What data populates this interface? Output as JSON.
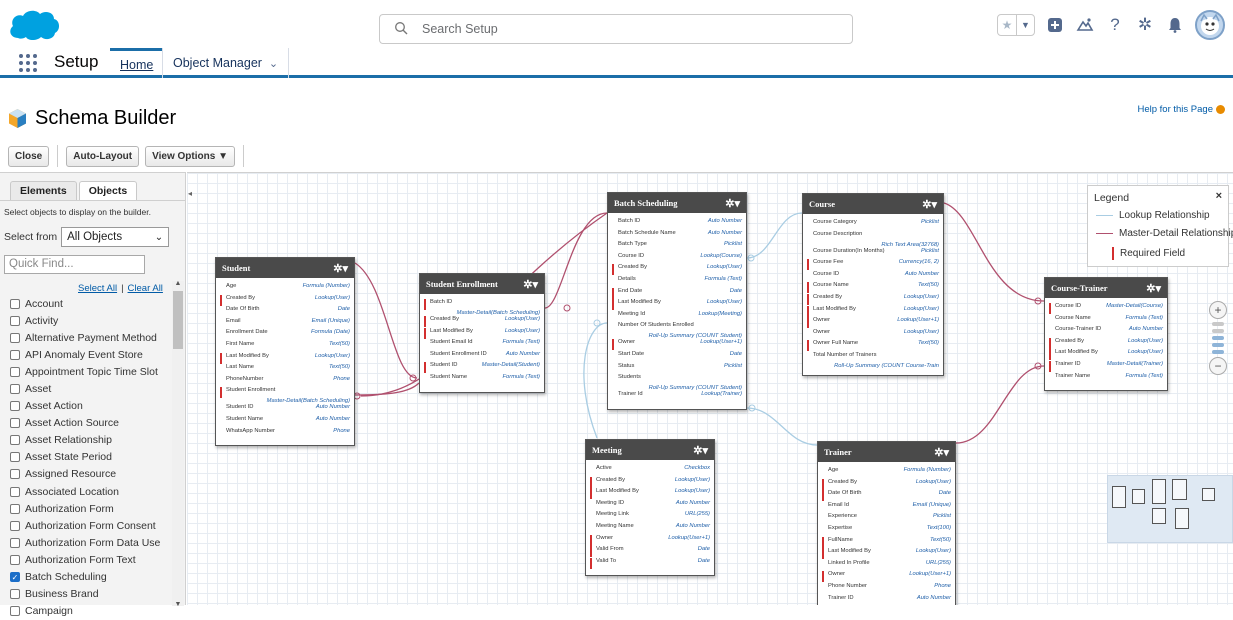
{
  "header": {
    "search_placeholder": "Search Setup",
    "brand_color": "#00a1e0",
    "icons": [
      "star-icon",
      "chevron-down-icon",
      "add-icon",
      "trailhead-icon",
      "help-icon",
      "gear-icon",
      "bell-icon",
      "avatar"
    ]
  },
  "context": {
    "app_name": "Setup",
    "tabs": [
      {
        "label": "Home"
      },
      {
        "label": "Object Manager"
      }
    ]
  },
  "page": {
    "title": "Schema Builder",
    "help_link": "Help for this Page"
  },
  "toolbar": {
    "close": "Close",
    "auto_layout": "Auto-Layout",
    "view_options": "View Options ▼"
  },
  "left_panel": {
    "tabs": [
      "Elements",
      "Objects"
    ],
    "hint": "Select objects to display on the builder.",
    "select_from_label": "Select from",
    "select_from_value": "All Objects",
    "quick_find_placeholder": "Quick Find...",
    "select_all": "Select All",
    "clear_all": "Clear All",
    "objects": [
      {
        "name": "Account",
        "checked": false
      },
      {
        "name": "Activity",
        "checked": false
      },
      {
        "name": "Alternative Payment Method",
        "checked": false
      },
      {
        "name": "API Anomaly Event Store",
        "checked": false
      },
      {
        "name": "Appointment Topic Time Slot",
        "checked": false
      },
      {
        "name": "Asset",
        "checked": false
      },
      {
        "name": "Asset Action",
        "checked": false
      },
      {
        "name": "Asset Action Source",
        "checked": false
      },
      {
        "name": "Asset Relationship",
        "checked": false
      },
      {
        "name": "Asset State Period",
        "checked": false
      },
      {
        "name": "Assigned Resource",
        "checked": false
      },
      {
        "name": "Associated Location",
        "checked": false
      },
      {
        "name": "Authorization Form",
        "checked": false
      },
      {
        "name": "Authorization Form Consent",
        "checked": false
      },
      {
        "name": "Authorization Form Data Use",
        "checked": false
      },
      {
        "name": "Authorization Form Text",
        "checked": false
      },
      {
        "name": "Batch Scheduling",
        "checked": true
      },
      {
        "name": "Business Brand",
        "checked": false
      },
      {
        "name": "Campaign",
        "checked": false
      }
    ]
  },
  "legend": {
    "title": "Legend",
    "lookup": "Lookup Relationship",
    "master_detail": "Master-Detail Relationship",
    "required": "Required Field",
    "lookup_color": "#a9cde3",
    "master_detail_color": "#b0506e",
    "required_color": "#d32f2f"
  },
  "nodes": {
    "student": {
      "title": "Student",
      "fields": [
        {
          "name": "Age",
          "type": "Formula (Number)",
          "req": false
        },
        {
          "name": "Created By",
          "type": "Lookup(User)",
          "req": true
        },
        {
          "name": "Date Of Birth",
          "type": "Date",
          "req": false
        },
        {
          "name": "Email",
          "type": "Email (Unique)",
          "req": false
        },
        {
          "name": "Enrollment Date",
          "type": "Formula (Date)",
          "req": false
        },
        {
          "name": "First Name",
          "type": "Text(50)",
          "req": false
        },
        {
          "name": "Last Modified By",
          "type": "Lookup(User)",
          "req": true
        },
        {
          "name": "Last Name",
          "type": "Text(50)",
          "req": false
        },
        {
          "name": "PhoneNumber",
          "type": "Phone",
          "req": false
        },
        {
          "name": "Student Enrollment",
          "type": "Master-Detail(Batch Scheduling)",
          "req": true,
          "two": true
        },
        {
          "name": "Student ID",
          "type": "Auto Number",
          "req": false
        },
        {
          "name": "Student Name",
          "type": "Auto Number",
          "req": false
        },
        {
          "name": "WhatsApp Number",
          "type": "Phone",
          "req": false
        }
      ]
    },
    "enrollment": {
      "title": "Student Enrollment",
      "fields": [
        {
          "name": "Batch ID",
          "type": "Master-Detail(Batch Scheduling)",
          "req": true,
          "two": true
        },
        {
          "name": "Created By",
          "type": "Lookup(User)",
          "req": true
        },
        {
          "name": "Last Modified By",
          "type": "Lookup(User)",
          "req": true
        },
        {
          "name": "Student Email Id",
          "type": "Formula (Text)",
          "req": false
        },
        {
          "name": "Student Enrollment ID",
          "type": "Auto Number",
          "req": false
        },
        {
          "name": "Student ID",
          "type": "Master-Detail(Student)",
          "req": true
        },
        {
          "name": "Student Name",
          "type": "Formula (Text)",
          "req": false
        }
      ]
    },
    "batch": {
      "title": "Batch Scheduling",
      "fields": [
        {
          "name": "Batch ID",
          "type": "Auto Number",
          "req": false
        },
        {
          "name": "Batch Schedule Name",
          "type": "Auto Number",
          "req": false
        },
        {
          "name": "Batch Type",
          "type": "Picklist",
          "req": false
        },
        {
          "name": "Course ID",
          "type": "Lookup(Course)",
          "req": false
        },
        {
          "name": "Created By",
          "type": "Lookup(User)",
          "req": true
        },
        {
          "name": "Details",
          "type": "Formula (Text)",
          "req": false
        },
        {
          "name": "End Date",
          "type": "Date",
          "req": true
        },
        {
          "name": "Last Modified By",
          "type": "Lookup(User)",
          "req": true
        },
        {
          "name": "Meeting Id",
          "type": "Lookup(Meeting)",
          "req": false
        },
        {
          "name": "Number Of Students Enrolled",
          "type": "Roll-Up Summary (COUNT Student)",
          "req": false,
          "two": true
        },
        {
          "name": "Owner",
          "type": "Lookup(User+1)",
          "req": true
        },
        {
          "name": "Start Date",
          "type": "Date",
          "req": false
        },
        {
          "name": "Status",
          "type": "Picklist",
          "req": false
        },
        {
          "name": "Students",
          "type": "Roll-Up Summary (COUNT Student)",
          "req": false,
          "two": true
        },
        {
          "name": "Trainer Id",
          "type": "Lookup(Trainer)",
          "req": false
        }
      ]
    },
    "course": {
      "title": "Course",
      "fields": [
        {
          "name": "Course Category",
          "type": "Picklist",
          "req": false
        },
        {
          "name": "Course Description",
          "type": "Rich Text Area(32768)",
          "req": false,
          "two": true
        },
        {
          "name": "Course Duration(In Months)",
          "type": "Picklist",
          "req": false
        },
        {
          "name": "Course Fee",
          "type": "Currency(16, 2)",
          "req": true
        },
        {
          "name": "Course ID",
          "type": "Auto Number",
          "req": false
        },
        {
          "name": "Course Name",
          "type": "Text(50)",
          "req": true
        },
        {
          "name": "Created By",
          "type": "Lookup(User)",
          "req": true
        },
        {
          "name": "Last Modified By",
          "type": "Lookup(User)",
          "req": true
        },
        {
          "name": "Owner",
          "type": "Lookup(User+1)",
          "req": true
        },
        {
          "name": "Owner",
          "type": "Lookup(User)",
          "req": false
        },
        {
          "name": "Owner Full Name",
          "type": "Text(50)",
          "req": true
        },
        {
          "name": "Total Number of Trainers",
          "type": "Roll-Up Summary (COUNT Course-Train",
          "req": false,
          "two": true
        }
      ]
    },
    "course_trainer": {
      "title": "Course-Trainer",
      "fields": [
        {
          "name": "Course ID",
          "type": "Master-Detail(Course)",
          "req": true
        },
        {
          "name": "Course Name",
          "type": "Formula (Text)",
          "req": false
        },
        {
          "name": "Course-Trainer ID",
          "type": "Auto Number",
          "req": false
        },
        {
          "name": "Created By",
          "type": "Lookup(User)",
          "req": true
        },
        {
          "name": "Last Modified By",
          "type": "Lookup(User)",
          "req": true
        },
        {
          "name": "Trainer ID",
          "type": "Master-Detail(Trainer)",
          "req": true
        },
        {
          "name": "Trainer Name",
          "type": "Formula (Text)",
          "req": false
        }
      ]
    },
    "meeting": {
      "title": "Meeting",
      "fields": [
        {
          "name": "Active",
          "type": "Checkbox",
          "req": false
        },
        {
          "name": "Created By",
          "type": "Lookup(User)",
          "req": true
        },
        {
          "name": "Last Modified By",
          "type": "Lookup(User)",
          "req": true
        },
        {
          "name": "Meeting ID",
          "type": "Auto Number",
          "req": false
        },
        {
          "name": "Meeting Link",
          "type": "URL(255)",
          "req": false
        },
        {
          "name": "Meeting Name",
          "type": "Auto Number",
          "req": false
        },
        {
          "name": "Owner",
          "type": "Lookup(User+1)",
          "req": true
        },
        {
          "name": "Valid From",
          "type": "Date",
          "req": true
        },
        {
          "name": "Valid To",
          "type": "Date",
          "req": true
        }
      ]
    },
    "trainer": {
      "title": "Trainer",
      "fields": [
        {
          "name": "Age",
          "type": "Formula (Number)",
          "req": false
        },
        {
          "name": "Created By",
          "type": "Lookup(User)",
          "req": true
        },
        {
          "name": "Date Of Birth",
          "type": "Date",
          "req": true
        },
        {
          "name": "Email Id",
          "type": "Email (Unique)",
          "req": false
        },
        {
          "name": "Experience",
          "type": "Picklist",
          "req": false
        },
        {
          "name": "Expertise",
          "type": "Text(100)",
          "req": false
        },
        {
          "name": "FullName",
          "type": "Text(50)",
          "req": true
        },
        {
          "name": "Last Modified By",
          "type": "Lookup(User)",
          "req": true
        },
        {
          "name": "Linked In Profile",
          "type": "URL(255)",
          "req": false
        },
        {
          "name": "Owner",
          "type": "Lookup(User+1)",
          "req": true
        },
        {
          "name": "Phone Number",
          "type": "Phone",
          "req": false
        },
        {
          "name": "Trainer ID",
          "type": "Auto Number",
          "req": false
        }
      ]
    }
  }
}
